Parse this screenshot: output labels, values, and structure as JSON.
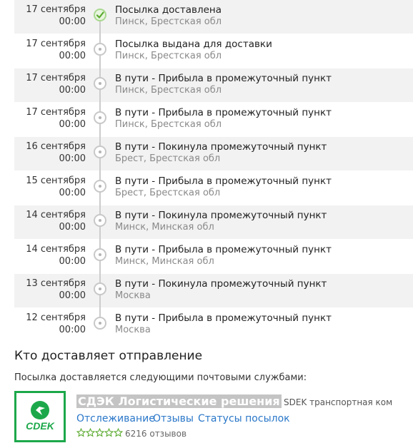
{
  "events": [
    {
      "date": "17 сентября",
      "time": "00:00",
      "status": "Посылка доставлена",
      "place": "Пинск, Брестская обл",
      "delivered": true
    },
    {
      "date": "17 сентября",
      "time": "00:00",
      "status": "Посылка выдана для доставки",
      "place": "Пинск, Брестская обл",
      "delivered": false
    },
    {
      "date": "17 сентября",
      "time": "00:00",
      "status": "В пути - Прибыла в промежуточный пункт",
      "place": "Пинск, Брестская обл",
      "delivered": false
    },
    {
      "date": "17 сентября",
      "time": "00:00",
      "status": "В пути - Прибыла в промежуточный пункт",
      "place": "Пинск, Брестская обл",
      "delivered": false
    },
    {
      "date": "16 сентября",
      "time": "00:00",
      "status": "В пути - Покинула промежуточный пункт",
      "place": "Брест, Брестская обл",
      "delivered": false
    },
    {
      "date": "15 сентября",
      "time": "00:00",
      "status": "В пути - Прибыла в промежуточный пункт",
      "place": "Брест, Брестская обл",
      "delivered": false
    },
    {
      "date": "14 сентября",
      "time": "00:00",
      "status": "В пути - Покинула промежуточный пункт",
      "place": "Минск, Минская обл",
      "delivered": false
    },
    {
      "date": "14 сентября",
      "time": "00:00",
      "status": "В пути - Прибыла в промежуточный пункт",
      "place": "Минск, Минская обл",
      "delivered": false
    },
    {
      "date": "13 сентября",
      "time": "00:00",
      "status": "В пути - Покинула промежуточный пункт",
      "place": "Москва",
      "delivered": false
    },
    {
      "date": "12 сентября",
      "time": "00:00",
      "status": "В пути - Прибыла в промежуточный пункт",
      "place": "Москва",
      "delivered": false
    }
  ],
  "carriers_section": {
    "heading": "Кто доставляет отправление",
    "subtitle": "Посылка доставляется следующими почтовыми службами:"
  },
  "carrier": {
    "logo_text": "CDEK",
    "name": "СДЭК Логистические решения",
    "description": "SDEK транспортная компания",
    "links": [
      "Отслеживание",
      "Отзывы",
      "Статусы посылок"
    ],
    "rating_stars": 5,
    "reviews": "6216 отзывов"
  },
  "colors": {
    "row_alt": "#f2f2f2",
    "delivered_check": "#5aaa2e",
    "brand_green": "#1ca84a",
    "link": "#2a77c9",
    "star": "#5aaa2e"
  }
}
